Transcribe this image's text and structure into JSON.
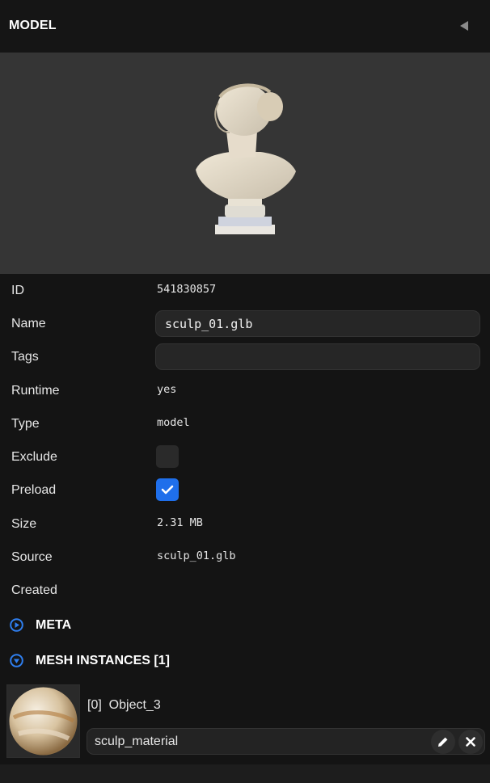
{
  "panel": {
    "title": "MODEL",
    "collapse_icon": "triangle-left-icon"
  },
  "preview": {
    "subject": "bust-sculpture-thumbnail"
  },
  "properties": {
    "id_label": "ID",
    "id_value": "541830857",
    "name_label": "Name",
    "name_value": "sculp_01.glb",
    "tags_label": "Tags",
    "tags_value": "",
    "runtime_label": "Runtime",
    "runtime_value": "yes",
    "type_label": "Type",
    "type_value": "model",
    "exclude_label": "Exclude",
    "exclude_checked": false,
    "preload_label": "Preload",
    "preload_checked": true,
    "size_label": "Size",
    "size_value": "2.31 MB",
    "source_label": "Source",
    "source_value": "sculp_01.glb",
    "created_label": "Created",
    "created_value": ""
  },
  "sections": {
    "meta_title": "META",
    "meta_state": "collapsed",
    "mesh_title": "MESH INSTANCES [1]",
    "mesh_state": "expanded"
  },
  "mesh_instances": [
    {
      "name": "[0]  Object_3",
      "material": "sculp_material",
      "edit_icon": "pencil-icon",
      "remove_icon": "close-icon"
    }
  ],
  "colors": {
    "accent": "#1f6feb",
    "background": "#141414",
    "header": "#151515",
    "preview": "#353535"
  }
}
